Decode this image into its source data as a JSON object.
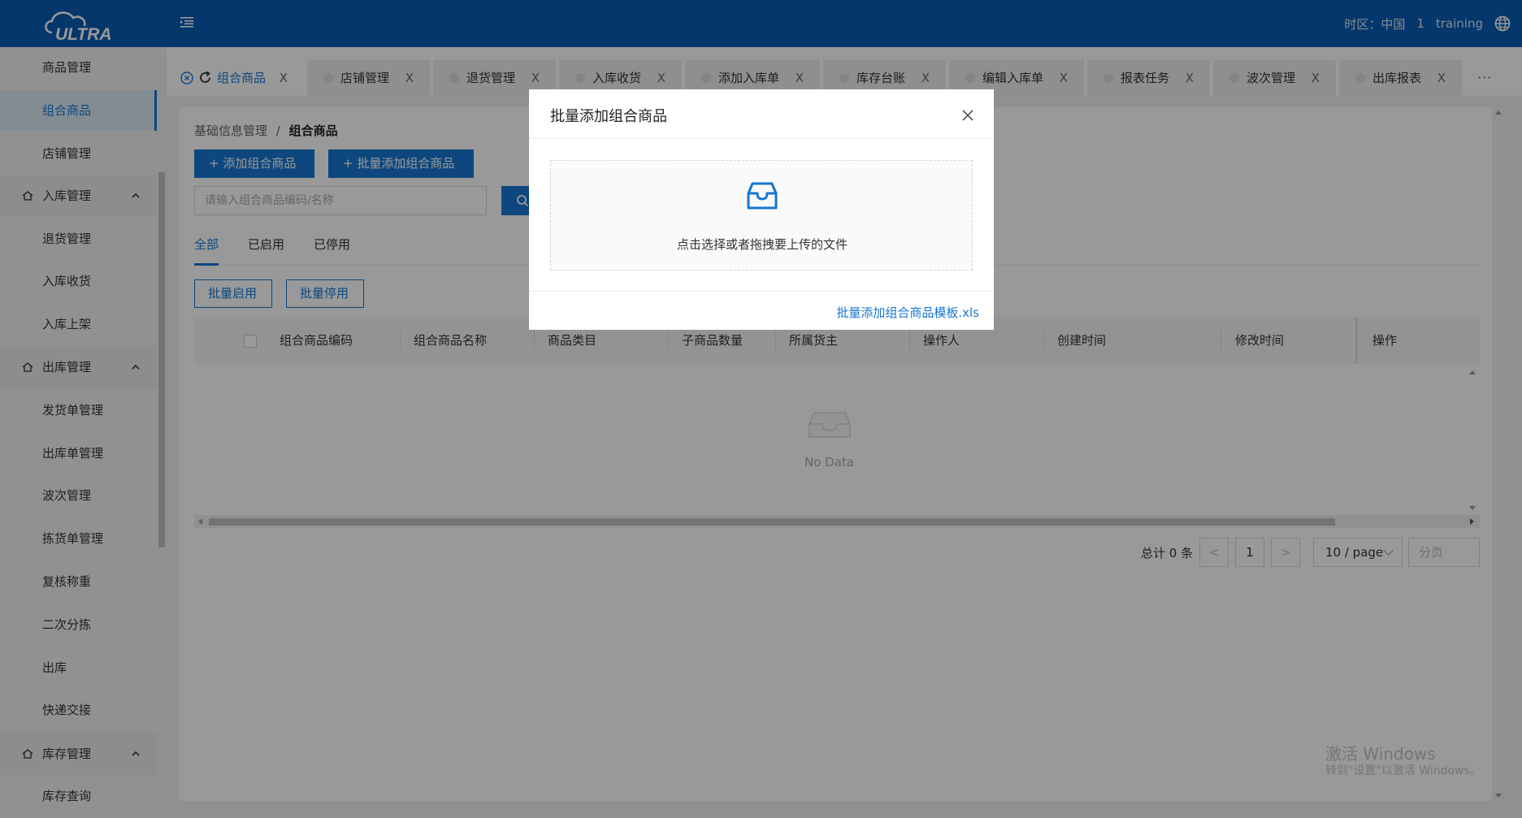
{
  "header": {
    "logo_text": "ULTRA",
    "timezone": "时区：中国",
    "count": "1",
    "user": "training",
    "brand_color": "#0a5db5",
    "accent_color": "#1677d2"
  },
  "sidebar": {
    "items": [
      {
        "label": "商品管理"
      },
      {
        "label": "组合商品",
        "active": true
      },
      {
        "label": "店铺管理"
      }
    ],
    "groups": [
      {
        "label": "入库管理",
        "icon": "house-icon",
        "expanded": true,
        "items": [
          "退货管理",
          "入库收货",
          "入库上架"
        ]
      },
      {
        "label": "出库管理",
        "icon": "house-icon",
        "expanded": true,
        "items": [
          "发货单管理",
          "出库单管理",
          "波次管理",
          "拣货单管理",
          "复核称重",
          "二次分拣",
          "出库",
          "快递交接"
        ]
      },
      {
        "label": "库存管理",
        "icon": "house-icon",
        "expanded": true,
        "items": [
          "库存查询"
        ]
      }
    ]
  },
  "tabs": [
    {
      "label": "组合商品",
      "active": true
    },
    {
      "label": "店铺管理"
    },
    {
      "label": "退货管理"
    },
    {
      "label": "入库收货"
    },
    {
      "label": "添加入库单"
    },
    {
      "label": "库存台账"
    },
    {
      "label": "编辑入库单"
    },
    {
      "label": "报表任务"
    },
    {
      "label": "波次管理"
    },
    {
      "label": "出库报表"
    }
  ],
  "tabs_close": "X",
  "tabs_more": "···",
  "breadcrumb": {
    "parent": "基础信息管理",
    "separator": "/",
    "current": "组合商品"
  },
  "toolbar": {
    "add_label": "+ 添加组合商品",
    "batch_add_label": "+ 批量添加组合商品",
    "search_placeholder": "请输入组合商品编码/名称"
  },
  "filter_tabs": [
    {
      "label": "全部",
      "active": true
    },
    {
      "label": "已启用"
    },
    {
      "label": "已停用"
    }
  ],
  "batch": {
    "enable": "批量启用",
    "disable": "批量停用"
  },
  "table": {
    "columns": [
      "组合商品编码",
      "组合商品名称",
      "商品类目",
      "子商品数量",
      "所属货主",
      "操作人",
      "创建时间",
      "修改时间",
      "操作"
    ],
    "rows": [],
    "empty_text": "No Data"
  },
  "pagination": {
    "total": "总计 0 条",
    "prev": "<",
    "page": "1",
    "next": ">",
    "page_size": "10 / page",
    "goto": "分页"
  },
  "watermark": {
    "line1": "激活 Windows",
    "line2": "转到\"设置\"以激活 Windows。"
  },
  "modal": {
    "title": "批量添加组合商品",
    "upload_text": "点击选择或者拖拽要上传的文件",
    "template_link": "批量添加组合商品模板.xls"
  }
}
